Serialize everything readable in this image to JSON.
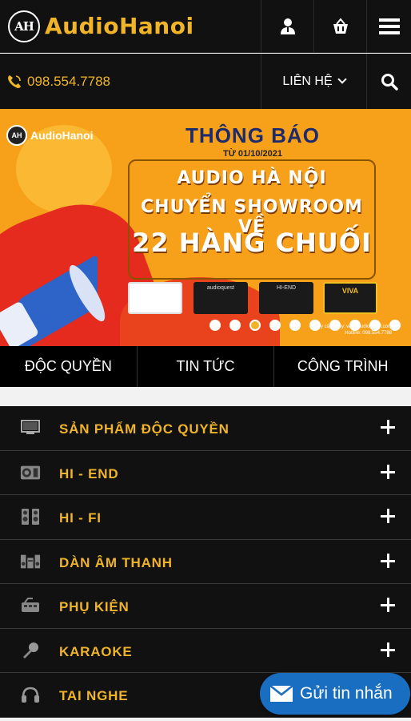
{
  "header": {
    "logo_mark": "AH",
    "logo_text": "AudioHanoi",
    "account_icon": "user-icon",
    "cart_icon": "basket-icon",
    "menu_icon": "hamburger-icon"
  },
  "subheader": {
    "phone": "098.554.7788",
    "contact_label": "LIÊN HỆ",
    "search_icon": "search-icon"
  },
  "banner": {
    "logo_text": "AudioHanoi",
    "title": "THÔNG BÁO",
    "date": "TỪ 01/10/2021",
    "line1": "AUDIO HÀ NỘI",
    "line2": "CHUYỂN SHOWROOM VỀ",
    "line3": "22 HÀNG CHUỐI",
    "product_labels": [
      "",
      "audioquest",
      "HI-END",
      "VIVA"
    ],
    "small_text": [
      "Truy cập ngay: www.audiohanoi.com",
      "Hotline: 098.554.7788"
    ],
    "slide_count": 10,
    "active_slide": 3
  },
  "tabs": [
    "ĐỘC QUYỀN",
    "TIN TỨC",
    "CÔNG TRÌNH"
  ],
  "categories": [
    {
      "label": "SẢN PHẨM ĐỘC QUYỀN",
      "icon": "monitor-icon"
    },
    {
      "label": "HI - END",
      "icon": "speaker-icon"
    },
    {
      "label": "HI - FI",
      "icon": "speaker-pair-icon"
    },
    {
      "label": "DÀN ÂM THANH",
      "icon": "sound-system-icon"
    },
    {
      "label": "PHỤ KIỆN",
      "icon": "accessory-icon"
    },
    {
      "label": "KARAOKE",
      "icon": "microphone-icon"
    },
    {
      "label": "TAI NGHE",
      "icon": "headphones-icon"
    }
  ],
  "chat": {
    "label": "Gửi tin nhắn",
    "icon": "envelope-icon"
  },
  "colors": {
    "accent": "#f0b429",
    "header_bg": "#111111",
    "chat_bg": "#1a6ec2"
  }
}
